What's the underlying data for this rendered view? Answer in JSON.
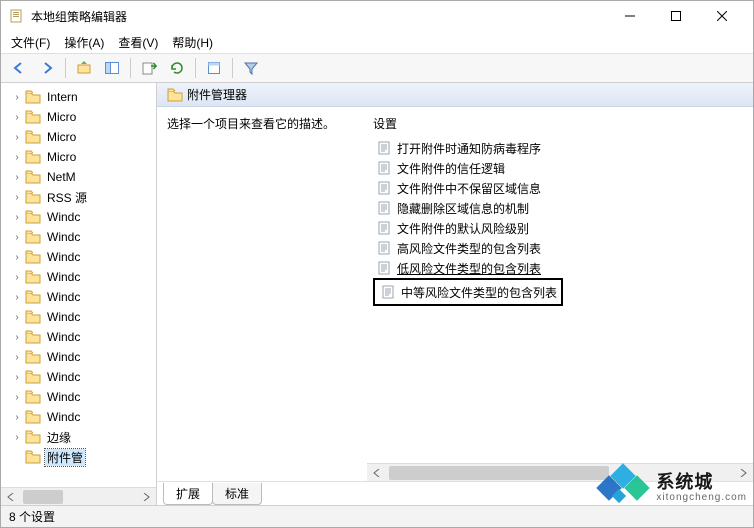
{
  "window": {
    "title": "本地组策略编辑器"
  },
  "menu": {
    "file": "文件(F)",
    "action": "操作(A)",
    "view": "查看(V)",
    "help": "帮助(H)"
  },
  "tree": {
    "items": [
      {
        "label": "Intern"
      },
      {
        "label": "Micro"
      },
      {
        "label": "Micro"
      },
      {
        "label": "Micro"
      },
      {
        "label": "NetM"
      },
      {
        "label": "RSS 源"
      },
      {
        "label": "Windc"
      },
      {
        "label": "Windc"
      },
      {
        "label": "Windc"
      },
      {
        "label": "Windc"
      },
      {
        "label": "Windc"
      },
      {
        "label": "Windc"
      },
      {
        "label": "Windc"
      },
      {
        "label": "Windc"
      },
      {
        "label": "Windc"
      },
      {
        "label": "Windc"
      },
      {
        "label": "Windc"
      },
      {
        "label": "边缘"
      },
      {
        "label": "附件管",
        "selected": true
      }
    ]
  },
  "header": {
    "title": "附件管理器"
  },
  "description_prompt": "选择一个项目来查看它的描述。",
  "column_header": "设置",
  "settings": [
    {
      "label": "打开附件时通知防病毒程序"
    },
    {
      "label": "文件附件的信任逻辑"
    },
    {
      "label": "文件附件中不保留区域信息"
    },
    {
      "label": "隐藏删除区域信息的机制"
    },
    {
      "label": "文件附件的默认风险级别"
    },
    {
      "label": "高风险文件类型的包含列表"
    },
    {
      "label": "低风险文件类型的包含列表",
      "underlined": true
    },
    {
      "label": "中等风险文件类型的包含列表",
      "highlighted": true
    }
  ],
  "tabs": {
    "extended": "扩展",
    "standard": "标准"
  },
  "status": "8 个设置",
  "watermark": {
    "brand": "系统城",
    "url": "xitongcheng.com"
  }
}
